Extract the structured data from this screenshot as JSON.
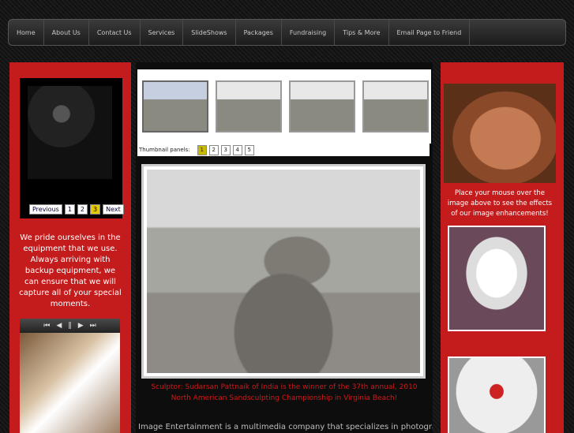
{
  "nav": [
    {
      "label": "Home"
    },
    {
      "label": "About Us"
    },
    {
      "label": "Contact Us"
    },
    {
      "label": "Services"
    },
    {
      "label": "SlideShows"
    },
    {
      "label": "Packages"
    },
    {
      "label": "Fundraising"
    },
    {
      "label": "Tips & More"
    },
    {
      "label": "Email Page to Friend"
    }
  ],
  "left": {
    "pager": {
      "previous": "Previous",
      "pages": [
        "1",
        "2",
        "3"
      ],
      "active_page": "3",
      "next": "Next"
    },
    "text": "We pride ourselves in the equipment that we use. Always arriving with backup equipment, we can ensure that we will capture all of your special moments.",
    "player_controls": [
      "prev-track-icon",
      "rewind-icon",
      "pause-icon",
      "play-icon",
      "next-track-icon"
    ]
  },
  "center": {
    "thumbnail_label": "Thumbnail panels:",
    "thumbnail_panels": [
      "1",
      "2",
      "3",
      "4",
      "5"
    ],
    "active_panel": "1",
    "caption": "Sculptor: Sudarsan Pattnaik of India is the winner of the 37th annual, 2010 North American Sandsculpting Championship in Virginia Beach!",
    "body": "Image Entertainment is a multimedia company that specializes in photography"
  },
  "right": {
    "text": "Place your mouse over the image above to see the effects of our image enhancements!"
  }
}
